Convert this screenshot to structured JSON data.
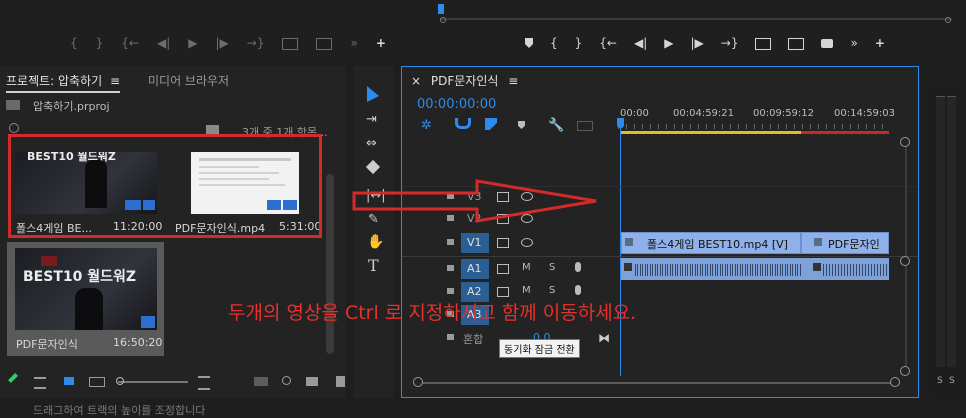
{
  "monitor": {
    "source_controls": [
      "{",
      "}",
      "{←",
      "◀|",
      "▶",
      "|▶",
      "→}",
      "",
      "",
      "»",
      "+"
    ],
    "program_controls": [
      "{",
      "}",
      "{←",
      "◀|",
      "▶",
      "|▶",
      "→}",
      "",
      "",
      "",
      "»",
      "+"
    ]
  },
  "project": {
    "tab_project": "프로젝트: 압축하기",
    "tab_menu": "≡",
    "tab_media": "미디어 브라우저",
    "file_name": "압축하기.prproj",
    "item_count": "3개 중 1개 항목...",
    "clips": [
      {
        "name": "폴스4게임 BE...",
        "duration": "11:20:00",
        "thumb_title": "BEST10 월드워Z"
      },
      {
        "name": "PDF문자인식.mp4",
        "duration": "5:31:00"
      },
      {
        "name": "PDF문자인식",
        "duration": "16:50:20",
        "thumb_title": "BEST10 월드워Z"
      }
    ]
  },
  "status_bar": "드래그하여 트랙의 높이를 조정합니다",
  "timeline": {
    "tab_close": "×",
    "tab_title": "PDF문자인식",
    "tab_menu": "≡",
    "timecode": "00:00:00:00",
    "ruler": [
      "00:00",
      "00:04:59:21",
      "00:09:59:12",
      "00:14:59:03"
    ],
    "tracks": [
      {
        "label": "V3",
        "kind": "video"
      },
      {
        "label": "V2",
        "kind": "video"
      },
      {
        "label": "V1",
        "kind": "video"
      },
      {
        "label": "A1",
        "kind": "audio",
        "m": "M",
        "s": "S"
      },
      {
        "label": "A2",
        "kind": "audio",
        "m": "M",
        "s": "S"
      },
      {
        "label": "A3",
        "kind": "audio",
        "m": "M",
        "s": "S"
      }
    ],
    "mix_label": "혼합",
    "mix_value": "0.0",
    "clip_v1_a": "폴스4게임 BEST10.mp4 [V]",
    "clip_v1_b": "PDF문자인",
    "tooltip": "동기화 잠금 전환"
  },
  "overlay_text": "두개의 영상을 Ctrl 로 지정하시고 함께 이동하세요.",
  "meter": {
    "s1": "S",
    "s2": "S"
  }
}
